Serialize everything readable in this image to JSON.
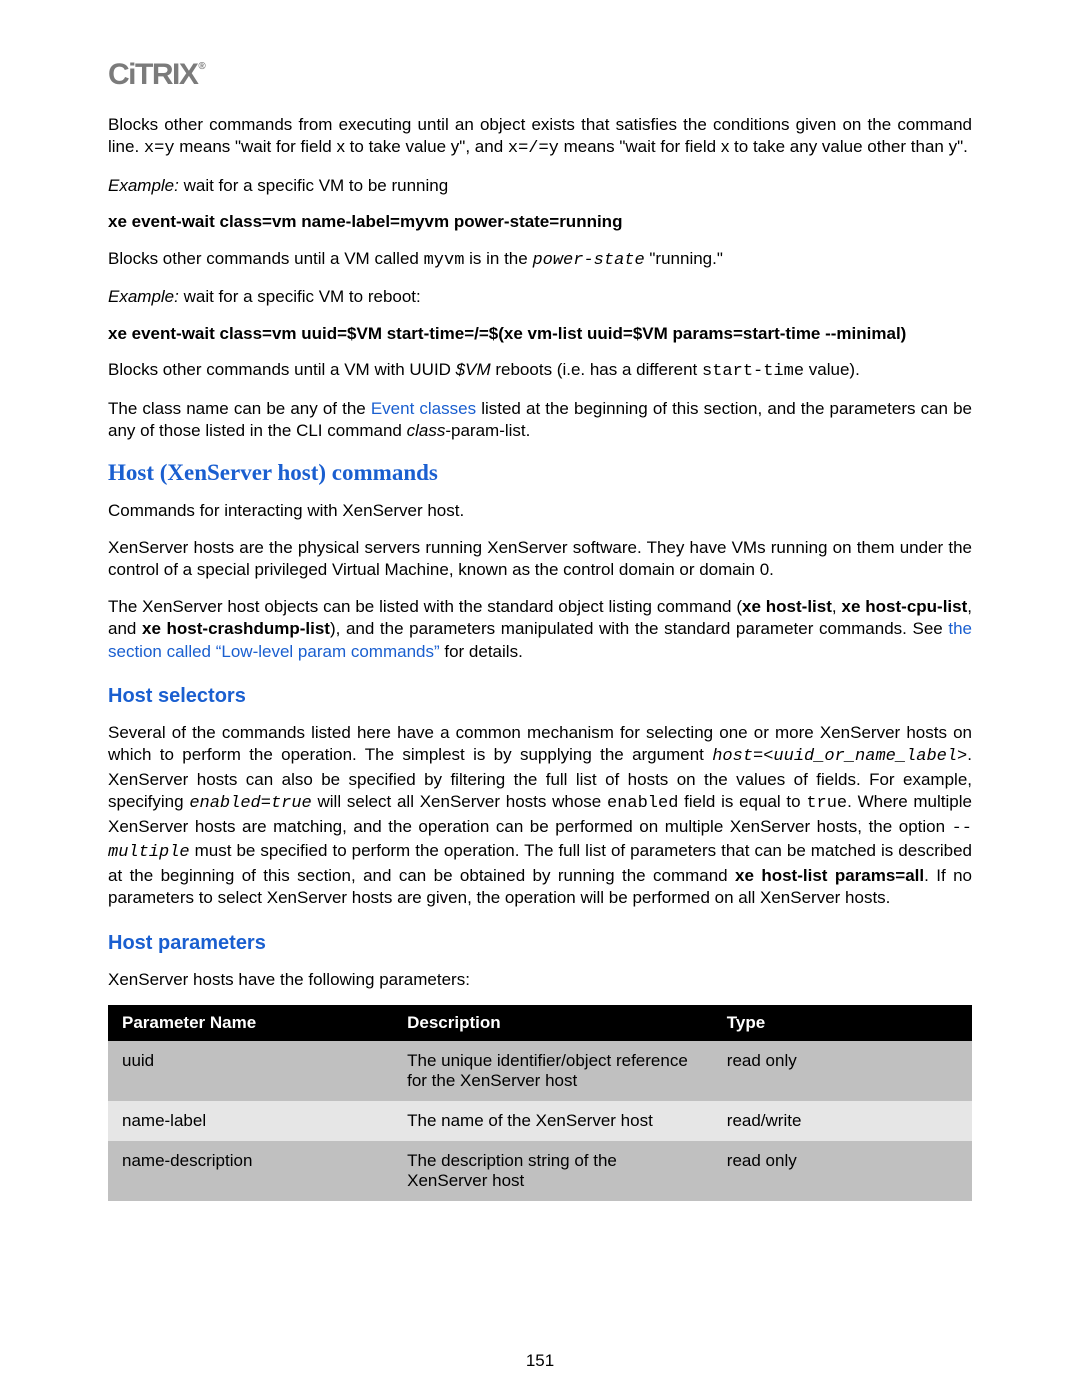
{
  "logo": "CITRIX",
  "p1_a": "Blocks other commands from executing until an object exists that satisfies the conditions given on the command line. ",
  "p1_code1": "x=y",
  "p1_b": " means \"wait for field x to take value y\", and ",
  "p1_code2": "x=/=y",
  "p1_c": " means \"wait for field x to take any value other than y\".",
  "p2_label": "Example:",
  "p2_text": " wait for a specific VM to be running",
  "cmd1": "xe event-wait class=vm name-label=myvm power-state=running",
  "p3_a": "Blocks other commands until a VM called ",
  "p3_code1": "myvm",
  "p3_b": " is in the ",
  "p3_code2": "power-state",
  "p3_c": " \"running.\"",
  "p4_label": "Example:",
  "p4_text": " wait for a specific VM to reboot:",
  "cmd2": "xe event-wait class=vm uuid=$VM start-time=/=$(xe vm-list uuid=$VM params=start-time --minimal)",
  "p5_a": "Blocks other commands until a VM with UUID ",
  "p5_em": "$VM",
  "p5_b": " reboots (i.e. has a different ",
  "p5_code": "start-time",
  "p5_c": " value).",
  "p6_a": "The class name can be any of the ",
  "p6_link": "Event classes",
  "p6_b": " listed at the beginning of this section, and the parameters can be any of those listed in the CLI command ",
  "p6_em": "class",
  "p6_c": "-param-list.",
  "h_section": "Host (XenServer host) commands",
  "s_p1": " Commands for interacting with XenServer host.",
  "s_p2": "XenServer hosts are the physical servers running XenServer software. They have VMs running on them under the control of a special privileged Virtual Machine, known as the control domain or domain 0.",
  "s_p3_a": "The XenServer host objects can be listed with the standard object listing command (",
  "s_p3_b1": "xe host-list",
  "s_p3_b": ", ",
  "s_p3_b2": "xe host-cpu-list",
  "s_p3_c": ", and ",
  "s_p3_b3": "xe host-crashdump-list",
  "s_p3_d": "), and the parameters manipulated with the standard parameter commands. See ",
  "s_p3_link": "the section called “Low-level param commands”",
  "s_p3_e": " for details.",
  "h_sub1": "Host selectors",
  "sel_p_a": "Several of the commands listed here have a common mechanism for selecting one or more XenServer hosts on which to perform the operation. The simplest is by supplying the argument ",
  "sel_code1": "host=<uuid_or_name_label>",
  "sel_p_b": ". XenServer hosts can also be specified by filtering the full list of hosts on the values of fields. For example, specifying ",
  "sel_code2": "enabled=true",
  "sel_p_c": " will select all XenServer hosts whose ",
  "sel_code3": "enabled",
  "sel_p_d": " field is equal to ",
  "sel_code4": "true",
  "sel_p_e": ". Where multiple XenServer hosts are matching, and the operation can be performed on multiple XenServer hosts, the option ",
  "sel_code5": "--multiple",
  "sel_p_f": " must be specified to perform the operation. The full list of parameters that can be matched is described at the beginning of this section, and can be obtained by running the command ",
  "sel_b": "xe host-list params=all",
  "sel_p_g": ". If no parameters to select XenServer hosts are given, the operation will be performed on all XenServer hosts.",
  "h_sub2": "Host parameters",
  "params_intro": "XenServer hosts have the following parameters:",
  "table": {
    "headers": {
      "name": "Parameter Name",
      "desc": "Description",
      "type": "Type"
    },
    "rows": [
      {
        "name": "uuid",
        "desc": "The unique identifier/object reference for the XenServer host",
        "type": "read only"
      },
      {
        "name": "name-label",
        "desc": "The name of the XenServer host",
        "type": "read/write"
      },
      {
        "name": "name-description",
        "desc": "The description string of the XenServer host",
        "type": "read only"
      }
    ]
  },
  "page_number": "151"
}
